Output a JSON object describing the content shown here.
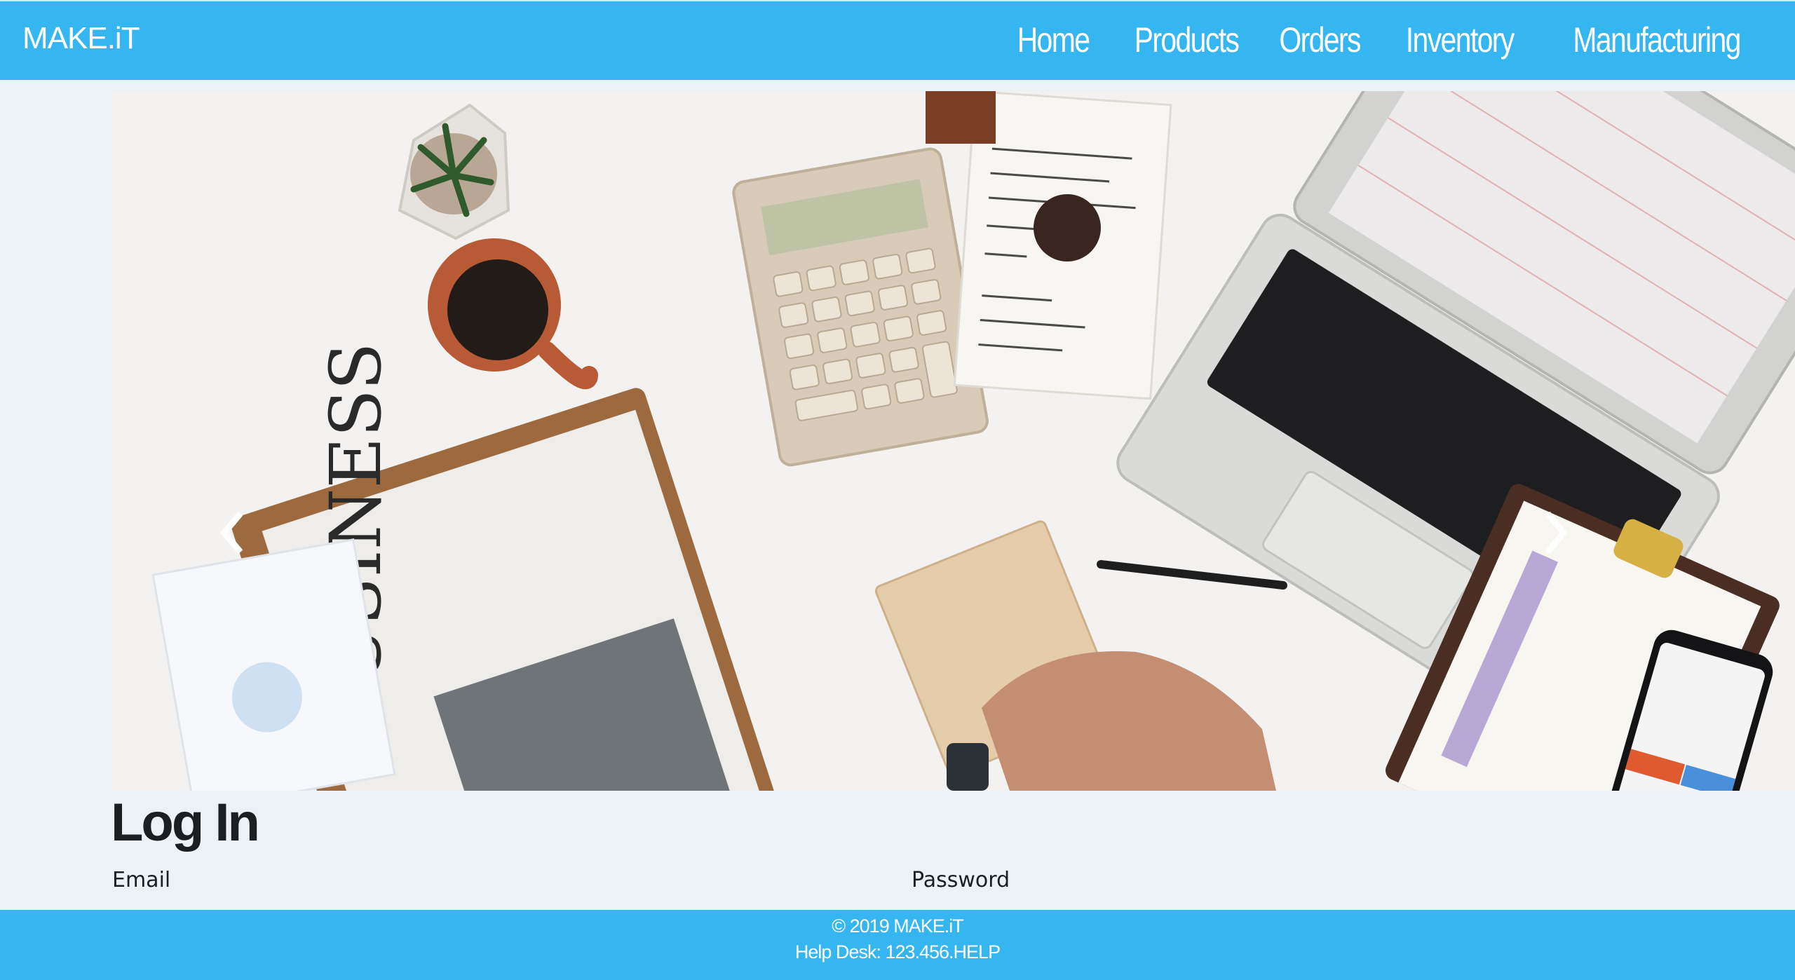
{
  "navbar": {
    "brand": "MAKE.iT",
    "links": [
      {
        "label": "Home"
      },
      {
        "label": "Products"
      },
      {
        "label": "Orders"
      },
      {
        "label": "Inventory"
      },
      {
        "label": "Manufacturing"
      }
    ]
  },
  "carousel": {
    "image": "overhead-office-desk-photo",
    "prev_icon": "chevron-left-icon",
    "next_icon": "chevron-right-icon",
    "slide_count": 6,
    "active_slide": 2
  },
  "login": {
    "title": "Log In",
    "email_label": "Email",
    "password_label": "Password"
  },
  "footer": {
    "copyright": "© 2019 MAKE.iT",
    "helpdesk": "Help Desk: 123.456.HELP"
  },
  "colors": {
    "brand_blue": "#36b6f1",
    "page_bg": "#ebf1f5",
    "text_dark": "#1c1f22"
  }
}
